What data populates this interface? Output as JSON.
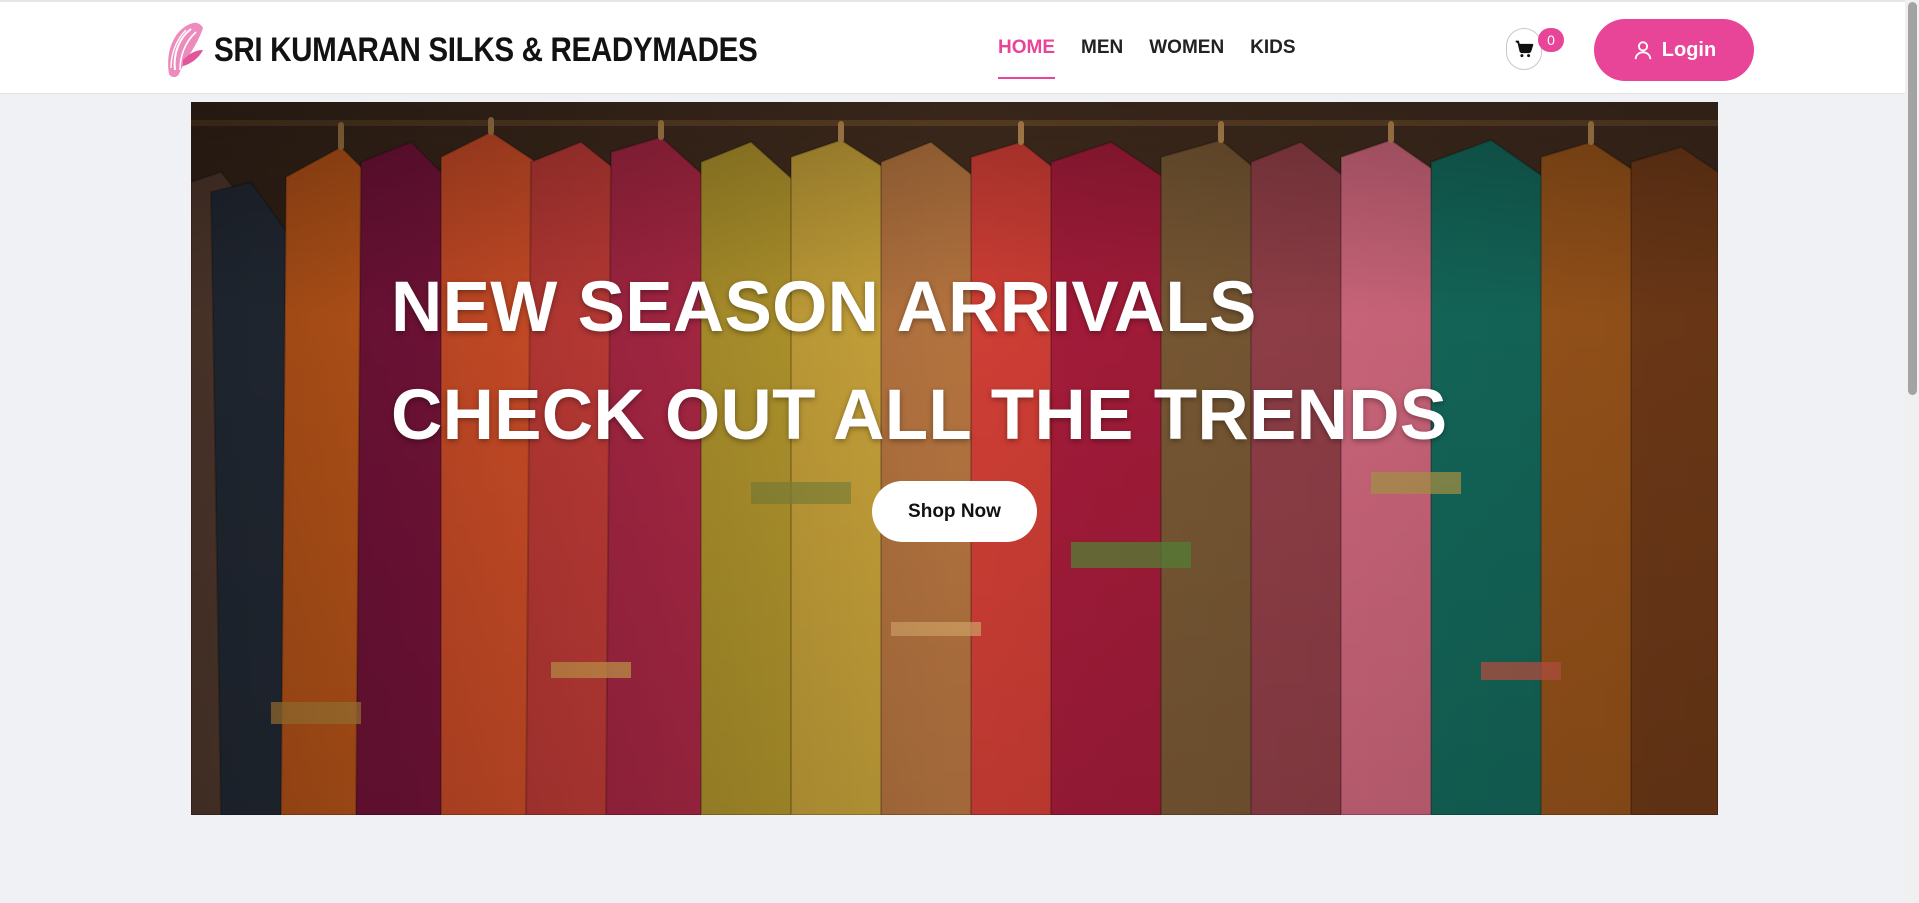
{
  "brand": {
    "name": "SRI KUMARAN SILKS & READYMADES",
    "logo_icon": "saree-leaf-logo"
  },
  "nav": {
    "items": [
      {
        "label": "HOME",
        "active": true
      },
      {
        "label": "MEN",
        "active": false
      },
      {
        "label": "WOMEN",
        "active": false
      },
      {
        "label": "KIDS",
        "active": false
      }
    ]
  },
  "cart": {
    "icon": "cart-icon",
    "count": "0"
  },
  "login": {
    "label": "Login",
    "icon": "user-icon"
  },
  "hero": {
    "headline_1": "NEW SEASON ARRIVALS",
    "headline_2": "CHECK OUT ALL THE TRENDS",
    "cta_label": "Shop Now"
  },
  "colors": {
    "accent": "#e84598",
    "page_bg": "#f0f1f4",
    "header_bg": "#ffffff"
  }
}
